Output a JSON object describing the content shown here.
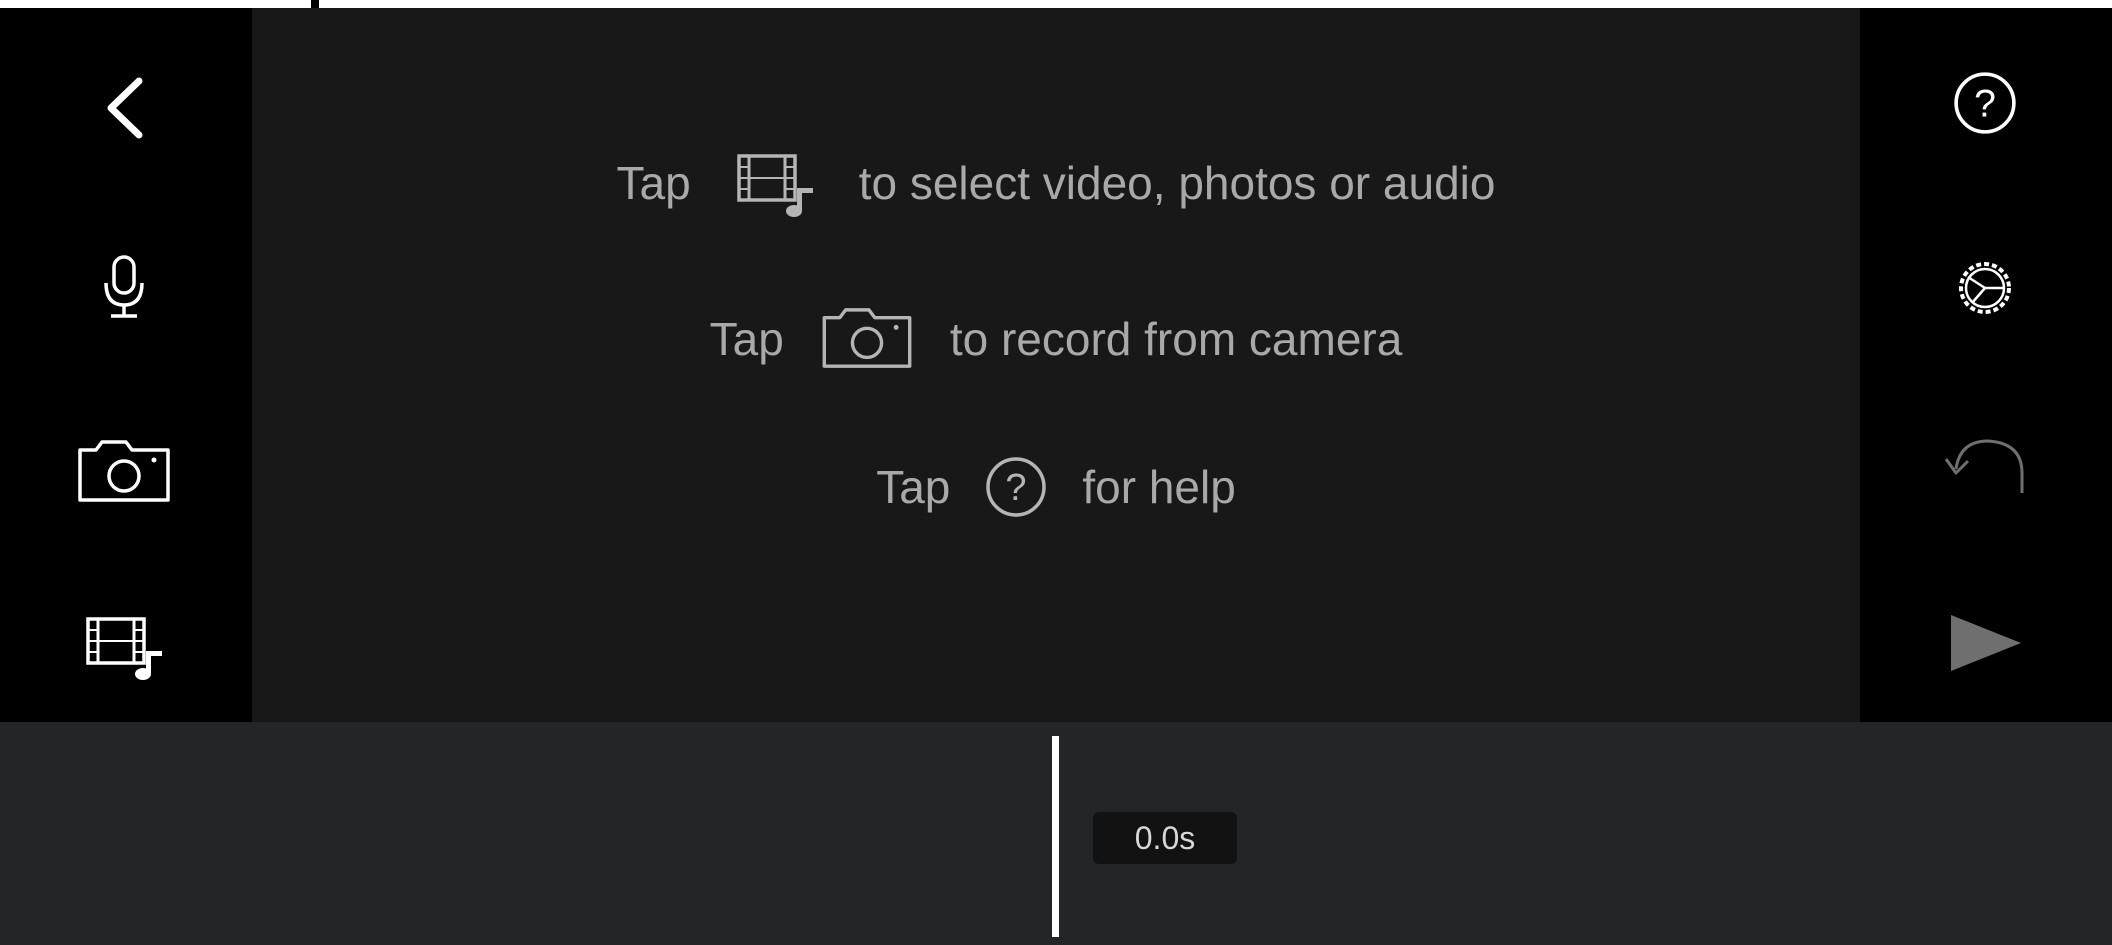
{
  "left_toolbar": {
    "items": [
      {
        "name": "back",
        "icon": "chevron-left-icon"
      },
      {
        "name": "record-audio",
        "icon": "microphone-icon"
      },
      {
        "name": "camera",
        "icon": "camera-icon"
      },
      {
        "name": "media-picker",
        "icon": "film-music-icon"
      }
    ]
  },
  "right_toolbar": {
    "items": [
      {
        "name": "help",
        "icon": "help-icon"
      },
      {
        "name": "settings",
        "icon": "gear-icon"
      },
      {
        "name": "undo",
        "icon": "undo-icon",
        "state": "disabled"
      },
      {
        "name": "play",
        "icon": "play-icon",
        "state": "disabled"
      }
    ]
  },
  "hints": {
    "line1": {
      "prefix": "Tap",
      "icon": "film-music-icon",
      "text": "to select video, photos or audio"
    },
    "line2": {
      "prefix": "Tap",
      "icon": "camera-icon",
      "text": "to record from camera"
    },
    "line3": {
      "prefix": "Tap",
      "icon": "help-icon",
      "text": "for help"
    }
  },
  "timeline": {
    "time": "0.0s"
  },
  "colors": {
    "rail": "#000000",
    "stage": "#181818",
    "timeline": "#242526",
    "hint_text": "#a9a9a9",
    "icon_active": "#ffffff",
    "icon_disabled": "#6f6f6f"
  }
}
